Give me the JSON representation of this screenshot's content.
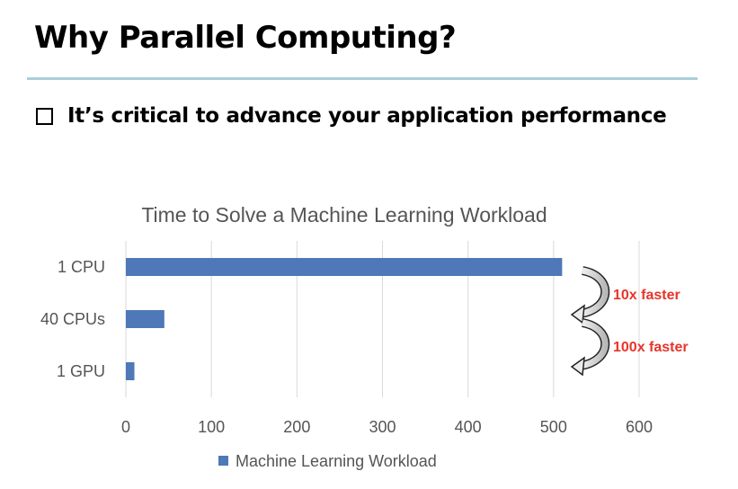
{
  "slide": {
    "title": "Why Parallel Computing?",
    "bullet": "It’s critical to advance your application performance"
  },
  "colors": {
    "bar": "#4e78b8",
    "annotation": "#e8342a",
    "rule": "#a9cfd8",
    "grid": "#d9d9d9"
  },
  "chart_data": {
    "type": "bar",
    "orientation": "horizontal",
    "title": "Time to Solve a Machine Learning Workload",
    "categories": [
      "1 CPU",
      "40 CPUs",
      "1 GPU"
    ],
    "series": [
      {
        "name": "Machine Learning Workload",
        "values": [
          510,
          45,
          10
        ]
      }
    ],
    "xlim": [
      0,
      600
    ],
    "xticks": [
      0,
      100,
      200,
      300,
      400,
      500,
      600
    ],
    "grid": true,
    "legend": "bottom",
    "annotations": [
      {
        "text": "10x faster",
        "from": "1 CPU",
        "to": "40 CPUs"
      },
      {
        "text": "100x faster",
        "from": "40 CPUs",
        "to": "1 GPU"
      }
    ]
  }
}
